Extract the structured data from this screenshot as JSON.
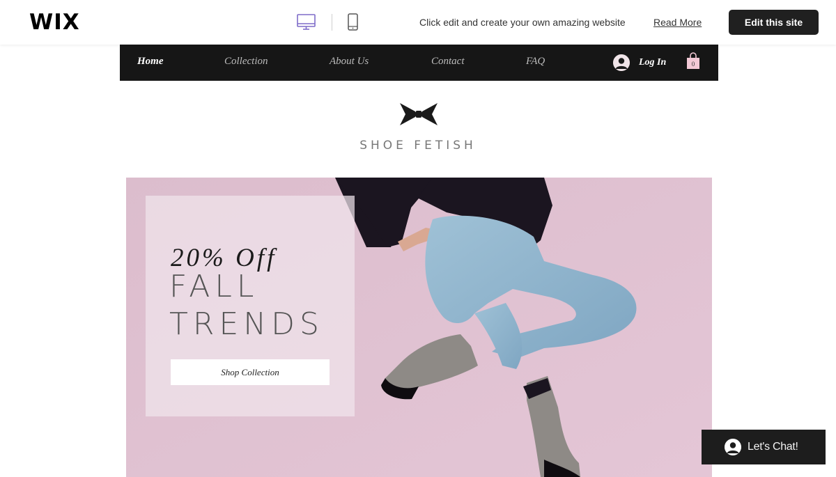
{
  "wix_bar": {
    "logo": "WIX",
    "message": "Click edit and create your own amazing website",
    "read_more": "Read More",
    "edit_button": "Edit this site",
    "devices": [
      "desktop-icon",
      "mobile-icon"
    ]
  },
  "nav": {
    "items": [
      "Home",
      "Collection",
      "About Us",
      "Contact",
      "FAQ"
    ],
    "active": "Home",
    "login": "Log In",
    "cart_count": "0"
  },
  "brand": {
    "name": "SHOE FETISH",
    "logo_icon": "bow-icon"
  },
  "hero": {
    "discount": "20% Off",
    "title": "FALL\nTRENDS",
    "cta": "Shop Collection",
    "background_color": "#dfc0d0"
  },
  "chat": {
    "label": "Let's Chat!"
  },
  "colors": {
    "nav_bg": "#161616",
    "button_dark": "#202020",
    "accent_pink": "#dfc0d0"
  }
}
